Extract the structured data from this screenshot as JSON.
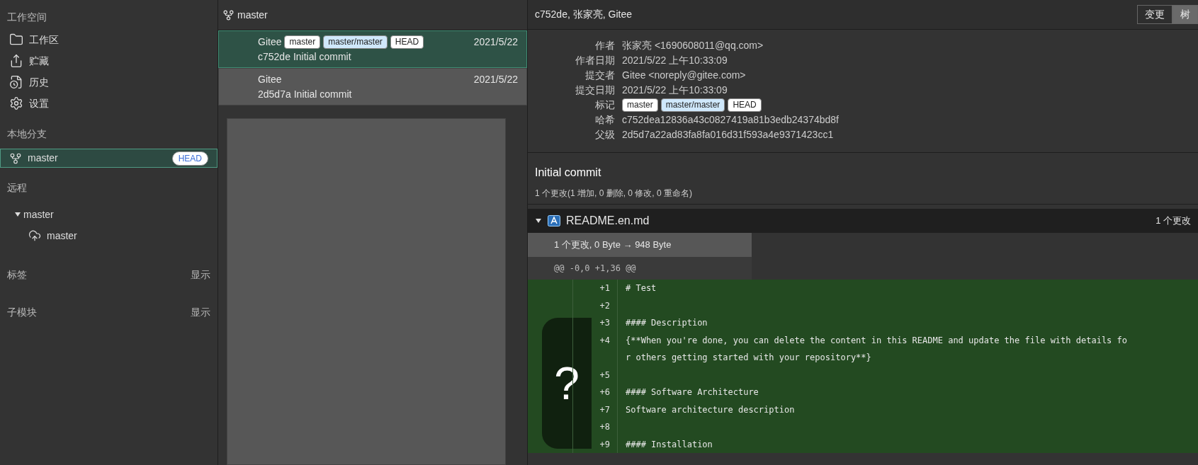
{
  "sidebar": {
    "workspace": {
      "title": "工作空间",
      "items": [
        {
          "kind": "folder",
          "label": "工作区",
          "selected": false
        },
        {
          "kind": "stash",
          "label": "贮藏",
          "selected": false
        },
        {
          "kind": "history",
          "label": "历史",
          "selected": false
        },
        {
          "kind": "settings",
          "label": "设置",
          "selected": false
        }
      ]
    },
    "local_branches": {
      "title": "本地分支",
      "items": [
        {
          "label": "master",
          "badge": "HEAD",
          "selected": true
        }
      ]
    },
    "remotes": {
      "title": "远程",
      "items": [
        {
          "label": "master",
          "expanded": true,
          "children": [
            {
              "label": "master"
            }
          ]
        }
      ]
    },
    "tags": {
      "title": "标签",
      "action": "显示"
    },
    "submodules": {
      "title": "子模块",
      "action": "显示"
    }
  },
  "commit_list": {
    "branch": "master",
    "commits": [
      {
        "author": "Gitee",
        "tags": [
          {
            "label": "master",
            "kind": "local"
          },
          {
            "label": "master/master",
            "kind": "remote"
          },
          {
            "label": "HEAD",
            "kind": "head"
          }
        ],
        "date": "2021/5/22",
        "hash": "c752de",
        "message": "Initial commit",
        "selected": true
      },
      {
        "author": "Gitee",
        "date": "2021/5/22",
        "hash": "2d5d7a",
        "message": "Initial commit",
        "selected": false
      }
    ]
  },
  "details": {
    "title": "c752de, 张家亮, Gitee",
    "tabs": [
      {
        "label": "变更",
        "selected": false
      },
      {
        "label": "树",
        "selected": true
      }
    ],
    "fields": [
      {
        "label": "作者",
        "value": "张家亮 <1690608011@qq.com>"
      },
      {
        "label": "作者日期",
        "value": "2021/5/22 上午10:33:09"
      },
      {
        "label": "提交者",
        "value": "Gitee <noreply@gitee.com>"
      },
      {
        "label": "提交日期",
        "value": "2021/5/22 上午10:33:09"
      },
      {
        "label": "标记",
        "tags": [
          {
            "label": "master",
            "kind": "local"
          },
          {
            "label": "master/master",
            "kind": "remote"
          },
          {
            "label": "HEAD",
            "kind": "head"
          }
        ]
      },
      {
        "label": "哈希",
        "value": "c752dea12836a43c0827419a81b3edb24374bd8f"
      },
      {
        "label": "父级",
        "value": "2d5d7a22ad83fa8fa016d31f593a4e9371423cc1"
      }
    ],
    "message": "Initial commit",
    "summary": "1 个更改(1 增加, 0 删除, 0 修改, 0 重命名)",
    "file": {
      "name": "README.en.md",
      "expanded": true,
      "changes": "1 个更改",
      "size_change": "1 个更改, 0 Byte → 948 Byte",
      "hunk": "@@ -0,0 +1,36 @@",
      "lines": [
        {
          "num": "+1",
          "text": "# Test"
        },
        {
          "num": "+2"
        },
        {
          "num": "+3",
          "text": "#### Description"
        },
        {
          "num": "+4",
          "text": "{**When you're done, you can delete the content in this README and update the file with details fo"
        },
        {
          "text": "r others getting started with your repository**}"
        },
        {
          "num": "+5"
        },
        {
          "num": "+6",
          "text": "#### Software Architecture"
        },
        {
          "num": "+7",
          "text": "Software architecture description"
        },
        {
          "num": "+8"
        },
        {
          "num": "+9",
          "text": "#### Installation"
        }
      ]
    }
  },
  "overlay": {
    "symbol": "?"
  }
}
